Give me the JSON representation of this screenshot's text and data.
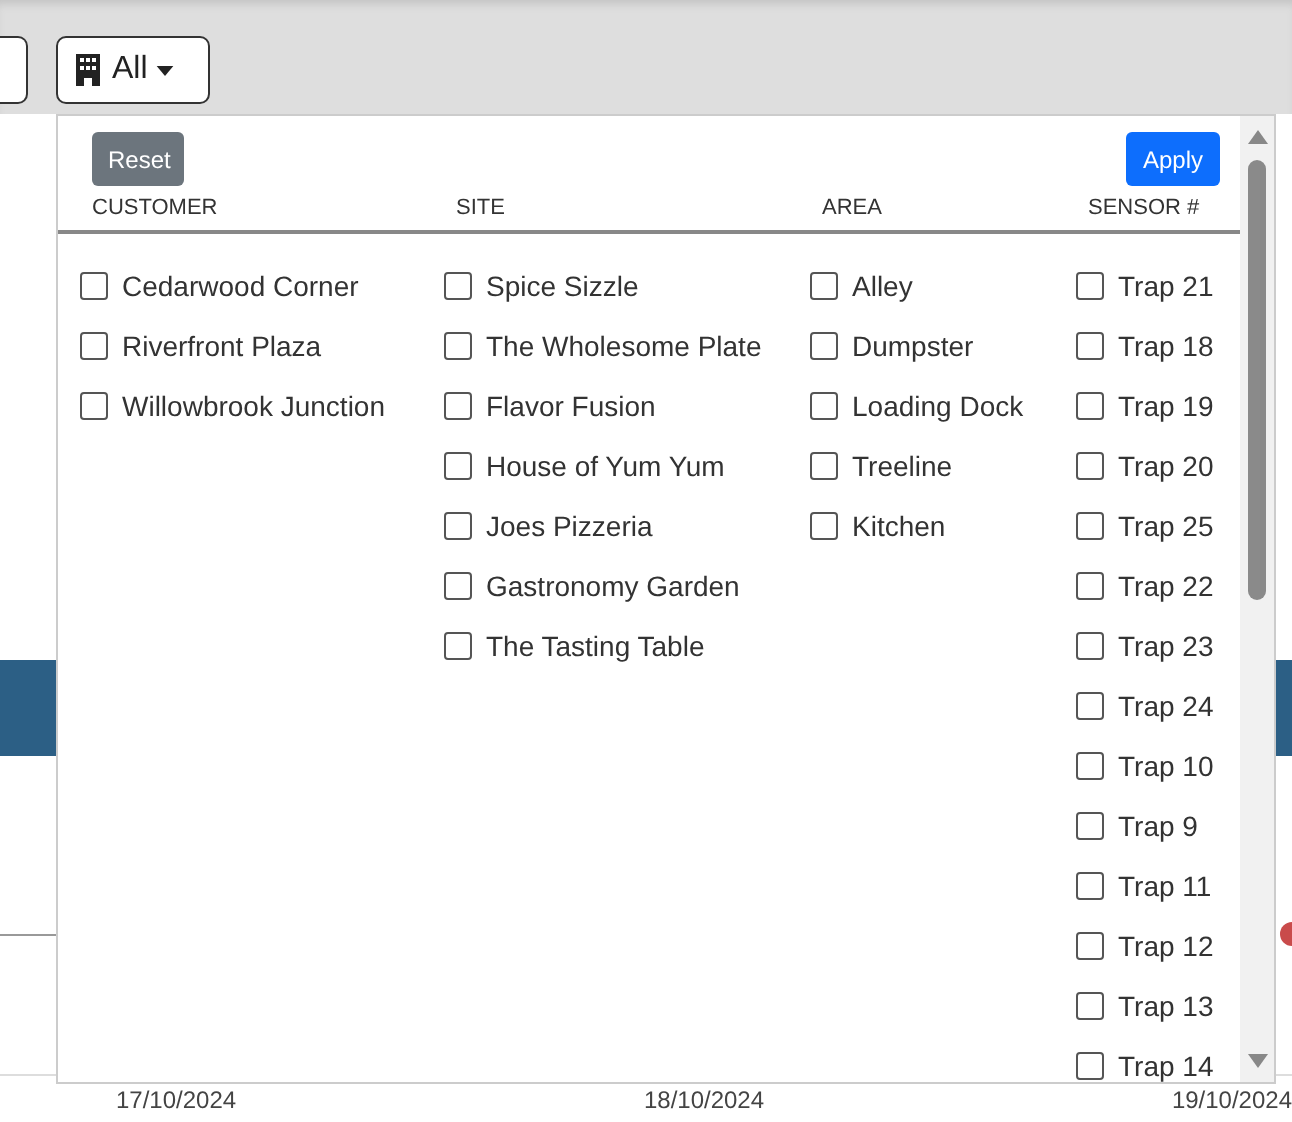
{
  "filter_button": {
    "label": "All"
  },
  "panel": {
    "reset_label": "Reset",
    "apply_label": "Apply",
    "columns": [
      {
        "heading": "CUSTOMER",
        "items": [
          {
            "label": "Cedarwood Corner",
            "checked": false
          },
          {
            "label": "Riverfront Plaza",
            "checked": false
          },
          {
            "label": "Willowbrook Junction",
            "checked": false
          }
        ]
      },
      {
        "heading": "SITE",
        "items": [
          {
            "label": "Spice Sizzle",
            "checked": false
          },
          {
            "label": "The Wholesome Plate",
            "checked": false
          },
          {
            "label": "Flavor Fusion",
            "checked": false
          },
          {
            "label": "House of Yum Yum",
            "checked": false
          },
          {
            "label": "Joes Pizzeria",
            "checked": false
          },
          {
            "label": "Gastronomy Garden",
            "checked": false
          },
          {
            "label": "The Tasting Table",
            "checked": false
          }
        ]
      },
      {
        "heading": "AREA",
        "items": [
          {
            "label": "Alley",
            "checked": false
          },
          {
            "label": "Dumpster",
            "checked": false
          },
          {
            "label": "Loading Dock",
            "checked": false
          },
          {
            "label": "Treeline",
            "checked": false
          },
          {
            "label": "Kitchen",
            "checked": false
          }
        ]
      },
      {
        "heading": "SENSOR #",
        "items": [
          {
            "label": "Trap 21",
            "checked": false
          },
          {
            "label": "Trap 18",
            "checked": false
          },
          {
            "label": "Trap 19",
            "checked": false
          },
          {
            "label": "Trap 20",
            "checked": false
          },
          {
            "label": "Trap 25",
            "checked": false
          },
          {
            "label": "Trap 22",
            "checked": false
          },
          {
            "label": "Trap 23",
            "checked": false
          },
          {
            "label": "Trap 24",
            "checked": false
          },
          {
            "label": "Trap 10",
            "checked": false
          },
          {
            "label": "Trap 9",
            "checked": false
          },
          {
            "label": "Trap 11",
            "checked": false
          },
          {
            "label": "Trap 12",
            "checked": false
          },
          {
            "label": "Trap 13",
            "checked": false
          },
          {
            "label": "Trap 14",
            "checked": false
          }
        ]
      }
    ]
  },
  "chart_axis": {
    "dates": [
      "17/10/2024",
      "18/10/2024",
      "19/10/2024"
    ]
  }
}
